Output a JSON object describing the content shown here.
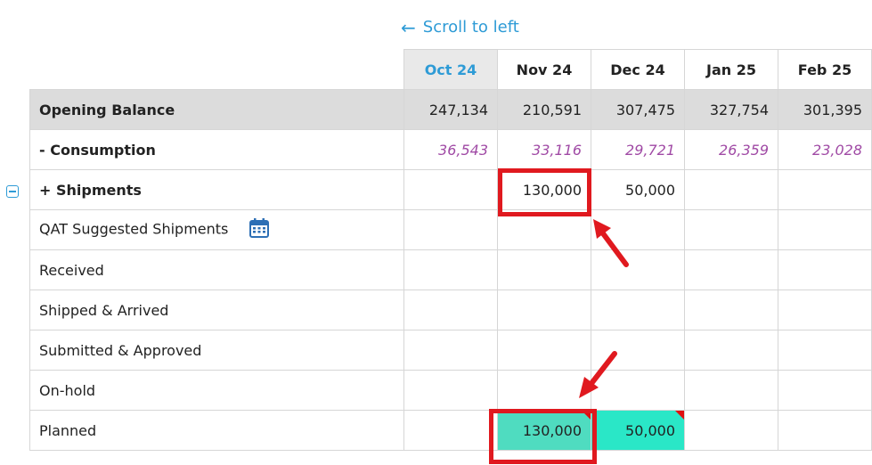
{
  "scroll_link": {
    "label": "Scroll to left"
  },
  "months": [
    {
      "label": "Oct 24",
      "current": true
    },
    {
      "label": "Nov 24",
      "current": false
    },
    {
      "label": "Dec 24",
      "current": false
    },
    {
      "label": "Jan 25",
      "current": false
    },
    {
      "label": "Feb 25",
      "current": false
    }
  ],
  "rows": {
    "opening_balance": {
      "label": "Opening Balance",
      "values": [
        "247,134",
        "210,591",
        "307,475",
        "327,754",
        "301,395"
      ]
    },
    "consumption": {
      "label": "- Consumption",
      "values": [
        "36,543",
        "33,116",
        "29,721",
        "26,359",
        "23,028"
      ]
    },
    "shipments": {
      "label": "+ Shipments",
      "values": [
        "",
        "130,000",
        "50,000",
        "",
        ""
      ]
    },
    "qat_suggested": {
      "label": "QAT Suggested Shipments"
    },
    "received": {
      "label": "Received"
    },
    "shipped_arrived": {
      "label": "Shipped & Arrived"
    },
    "submitted_approved": {
      "label": "Submitted & Approved"
    },
    "on_hold": {
      "label": "On-hold"
    },
    "planned": {
      "label": "Planned",
      "values": [
        "",
        "130,000",
        "50,000",
        "",
        ""
      ]
    }
  },
  "colors": {
    "accent": "#2e9bd6",
    "consumption": "#a04aa5",
    "planned_cell_1": "#4fdcc0",
    "planned_cell_2": "#2ae7c7",
    "annotation_red": "#e0191f"
  },
  "icons": {
    "scroll": "left-arrow-icon",
    "collapse": "collapse-minus-icon",
    "calendar": "calendar-icon"
  }
}
